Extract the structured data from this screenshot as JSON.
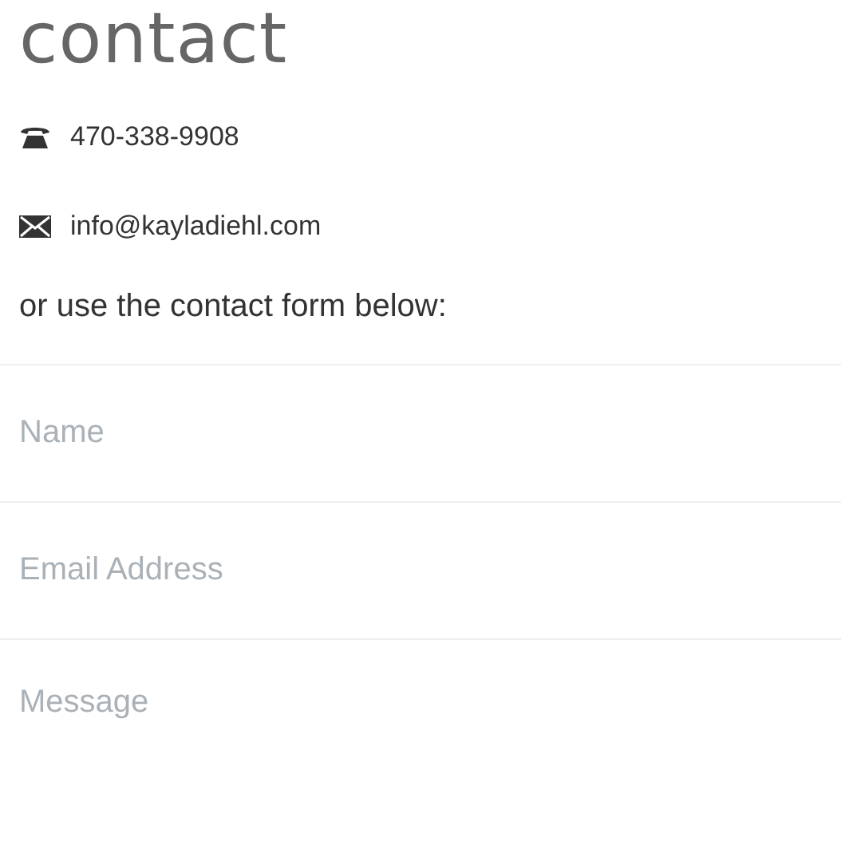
{
  "heading": "contact",
  "contacts": [
    {
      "kind": "phone",
      "text": "470-338-9908"
    },
    {
      "kind": "email",
      "text": "info@kayladiehl.com"
    }
  ],
  "intro": "or use the contact form below:",
  "form": {
    "fields": [
      {
        "kind": "input",
        "placeholder": "Name"
      },
      {
        "kind": "input",
        "placeholder": "Email Address"
      },
      {
        "kind": "textarea",
        "placeholder": "Message"
      }
    ]
  }
}
